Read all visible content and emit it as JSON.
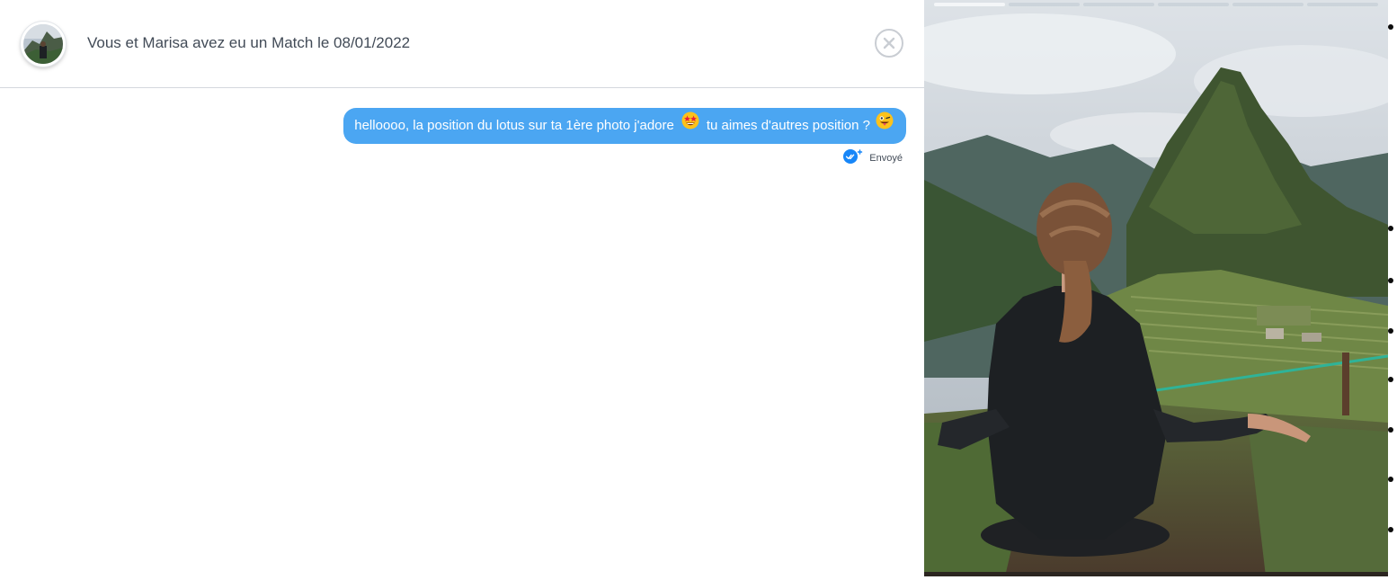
{
  "header": {
    "title": "Vous et Marisa avez eu un Match le 08/01/2022",
    "avatar_icon": "profile-photo",
    "close_icon": "close-circle-icon"
  },
  "messages": [
    {
      "text_part1": "helloooo, la position du lotus sur ta 1ère photo j'adore",
      "emoji1": "star-struck-emoji",
      "text_part2": "tu aimes d'autres position ?",
      "emoji2": "tongue-out-emoji",
      "status": "Envoyé",
      "status_icon": "double-check-icon"
    }
  ],
  "photo": {
    "icon": "profile-photo",
    "progress_segments": 6,
    "active_segment": 1
  },
  "colors": {
    "bubble": "#4ba6f2",
    "text": "#424b57",
    "divider": "#d4d8de"
  }
}
